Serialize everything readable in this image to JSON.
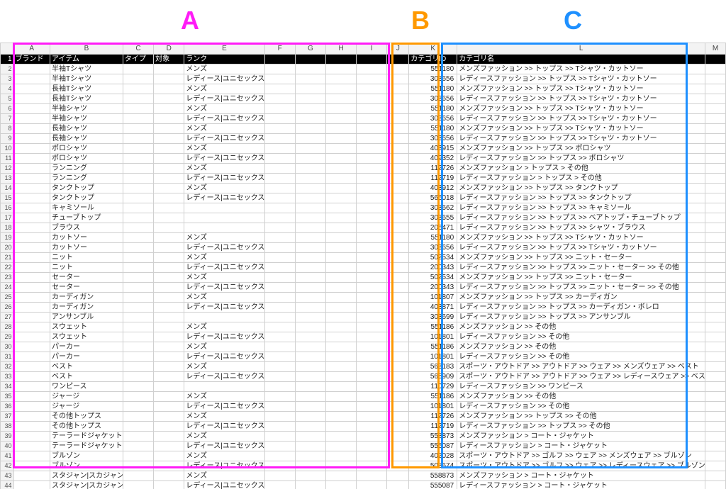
{
  "groups": {
    "A": "A",
    "B": "B",
    "C": "C"
  },
  "columns": [
    "A",
    "B",
    "C",
    "D",
    "E",
    "F",
    "G",
    "H",
    "I",
    "J",
    "K",
    "L",
    "M"
  ],
  "headerRow": {
    "A": "ブランド",
    "B": "アイテム",
    "C": "タイプ",
    "D": "対象",
    "E": "ランク",
    "K": "カテゴリID",
    "L": "カテゴリ名"
  },
  "rows": [
    {
      "B": "半袖Tシャツ",
      "E": "メンズ",
      "K": "551180",
      "L": "メンズファッション >> トップス >> Tシャツ・カットソー"
    },
    {
      "B": "半袖Tシャツ",
      "E": "レディース|ユニセックス",
      "K": "303656",
      "L": "レディースファッション >> トップス >> Tシャツ・カットソー"
    },
    {
      "B": "長袖Tシャツ",
      "E": "メンズ",
      "K": "551180",
      "L": "メンズファッション >> トップス >> Tシャツ・カットソー"
    },
    {
      "B": "長袖Tシャツ",
      "E": "レディース|ユニセックス",
      "K": "303656",
      "L": "レディースファッション >> トップス >> Tシャツ・カットソー"
    },
    {
      "B": "半袖シャツ",
      "E": "メンズ",
      "K": "551180",
      "L": "メンズファッション >> トップス >> Tシャツ・カットソー"
    },
    {
      "B": "半袖シャツ",
      "E": "レディース|ユニセックス",
      "K": "303656",
      "L": "レディースファッション >> トップス >> Tシャツ・カットソー"
    },
    {
      "B": "長袖シャツ",
      "E": "メンズ",
      "K": "551180",
      "L": "メンズファッション >> トップス >> Tシャツ・カットソー"
    },
    {
      "B": "長袖シャツ",
      "E": "レディース|ユニセックス",
      "K": "303656",
      "L": "レディースファッション >> トップス >> Tシャツ・カットソー"
    },
    {
      "B": "ポロシャツ",
      "E": "メンズ",
      "K": "403915",
      "L": "メンズファッション >> トップス >> ポロシャツ"
    },
    {
      "B": "ポロシャツ",
      "E": "レディース|ユニセックス",
      "K": "409352",
      "L": "レディースファッション >> トップス >> ポロシャツ"
    },
    {
      "B": "ランニング",
      "E": "メンズ",
      "K": "112726",
      "L": "メンズファッション > トップス > その他"
    },
    {
      "B": "ランニング",
      "E": "レディース|ユニセックス",
      "K": "112719",
      "L": "レディースファッション > トップス > その他"
    },
    {
      "B": "タンクトップ",
      "E": "メンズ",
      "K": "403912",
      "L": "メンズファッション >> トップス >> タンクトップ"
    },
    {
      "B": "タンクトップ",
      "E": "レディース|ユニセックス",
      "K": "566018",
      "L": "レディースファッション >> トップス >> タンクトップ"
    },
    {
      "B": "キャミソール",
      "E": "",
      "K": "303662",
      "L": "レディースファッション >> トップス >> キャミソール"
    },
    {
      "B": "チューブトップ",
      "E": "",
      "K": "303655",
      "L": "レディースファッション >> トップス >> ベアトップ・チューブトップ"
    },
    {
      "B": "ブラウス",
      "E": "",
      "K": "206471",
      "L": "レディースファッション >> トップス >> シャツ・ブラウス"
    },
    {
      "B": "カットソー",
      "E": "メンズ",
      "K": "551180",
      "L": "メンズファッション >> トップス >> Tシャツ・カットソー"
    },
    {
      "B": "カットソー",
      "E": "レディース|ユニセックス",
      "K": "303656",
      "L": "レディースファッション >> トップス >> Tシャツ・カットソー"
    },
    {
      "B": "ニット",
      "E": "メンズ",
      "K": "502534",
      "L": "メンズファッション >> トップス >> ニット・セーター"
    },
    {
      "B": "ニット",
      "E": "レディース|ユニセックス",
      "K": "200343",
      "L": "レディースファッション >> トップス >> ニット・セーター >> その他"
    },
    {
      "B": "セーター",
      "E": "メンズ",
      "K": "502534",
      "L": "メンズファッション >> トップス >> ニット・セーター"
    },
    {
      "B": "セーター",
      "E": "レディース|ユニセックス",
      "K": "200343",
      "L": "レディースファッション >> トップス >> ニット・セーター >> その他"
    },
    {
      "B": "カーディガン",
      "E": "メンズ",
      "K": "101807",
      "L": "メンズファッション >> トップス >> カーディガン"
    },
    {
      "B": "カーディガン",
      "E": "レディース|ユニセックス",
      "K": "403871",
      "L": "レディースファッション >> トップス >> カーディガン・ボレロ"
    },
    {
      "B": "アンサンブル",
      "E": "",
      "K": "303699",
      "L": "レディースファッション >> トップス >> アンサンブル"
    },
    {
      "B": "スウェット",
      "E": "メンズ",
      "K": "551186",
      "L": "メンズファッション >> その他"
    },
    {
      "B": "スウェット",
      "E": "レディース|ユニセックス",
      "K": "101801",
      "L": "レディースファッション >> その他"
    },
    {
      "B": "パーカー",
      "E": "メンズ",
      "K": "551186",
      "L": "メンズファッション >> その他"
    },
    {
      "B": "パーカー",
      "E": "レディース|ユニセックス",
      "K": "101801",
      "L": "レディースファッション >> その他"
    },
    {
      "B": "ベスト",
      "E": "メンズ",
      "K": "563183",
      "L": "スポーツ・アウトドア >> アウトドア >> ウェア >> メンズウェア >> ベスト"
    },
    {
      "B": "ベスト",
      "E": "レディース|ユニセックス",
      "K": "565909",
      "L": "スポーツ・アウトドア >> アウトドア >> ウェア >> レディースウェア >> ベスト"
    },
    {
      "B": "ワンピース",
      "E": "",
      "K": "110729",
      "L": "レディースファッション >> ワンピース"
    },
    {
      "B": "ジャージ",
      "E": "メンズ",
      "K": "551186",
      "L": "メンズファッション >> その他"
    },
    {
      "B": "ジャージ",
      "E": "レディース|ユニセックス",
      "K": "101801",
      "L": "レディースファッション >> その他"
    },
    {
      "B": "その他トップス",
      "E": "メンズ",
      "K": "112726",
      "L": "メンズファッション >> トップス >> その他"
    },
    {
      "B": "その他トップス",
      "E": "レディース|ユニセックス",
      "K": "112719",
      "L": "レディースファッション >> トップス >> その他"
    },
    {
      "B": "テーラードジャケット|デニムジャケット",
      "E": "メンズ",
      "K": "558873",
      "L": "メンズファッション > コート・ジャケット"
    },
    {
      "B": "テーラードジャケット|デニムジャケット",
      "E": "レディース|ユニセックス",
      "K": "555087",
      "L": "レディースファッション > コート・ジャケット"
    },
    {
      "B": "ブルゾン",
      "E": "メンズ",
      "K": "402028",
      "L": "スポーツ・アウトドア >> ゴルフ >> ウェア >> メンズウェア >> ブルゾン"
    },
    {
      "B": "ブルゾン",
      "E": "レディース|ユニセックス",
      "K": "508674",
      "L": "スポーツ・アウトドア >> ゴルフ >> ウェア >> レディースウェア >> ブルゾン"
    },
    {
      "B": "スタジャン|スカジャン|ダウンジャケット",
      "E": "メンズ",
      "K": "558873",
      "L": "メンズファッション > コート・ジャケット"
    },
    {
      "B": "スタジャン|スカジャン|ダウンジャケット",
      "E": "レディース|ユニセックス",
      "K": "555087",
      "L": "レディースファッション > コート・ジャケット"
    }
  ]
}
